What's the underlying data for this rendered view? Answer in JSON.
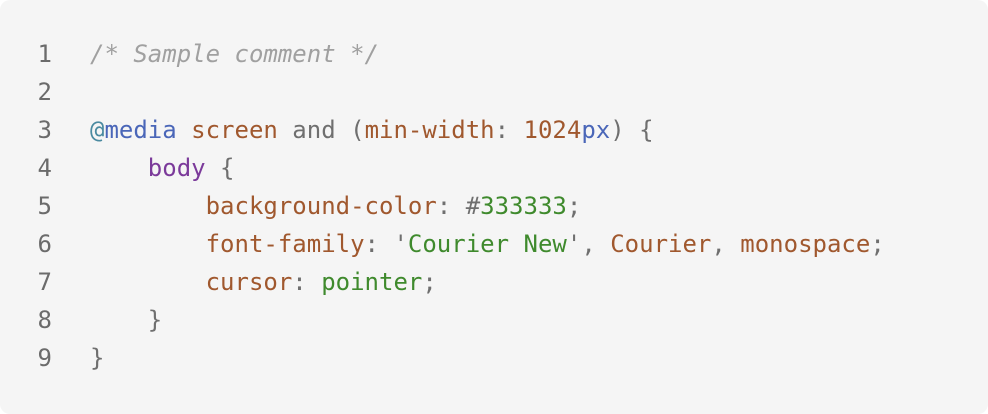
{
  "code": {
    "lines": [
      [
        {
          "text": "/* Sample comment */",
          "type": "comment"
        }
      ],
      [],
      [
        {
          "text": "@",
          "type": "at"
        },
        {
          "text": "media",
          "type": "keyword"
        },
        {
          "text": " ",
          "type": "punct"
        },
        {
          "text": "screen",
          "type": "ident"
        },
        {
          "text": " and ",
          "type": "punct"
        },
        {
          "text": "(",
          "type": "punct"
        },
        {
          "text": "min-width",
          "type": "ident"
        },
        {
          "text": ": ",
          "type": "punct"
        },
        {
          "text": "1024",
          "type": "num"
        },
        {
          "text": "px",
          "type": "unit"
        },
        {
          "text": ") {",
          "type": "punct"
        }
      ],
      [
        {
          "text": "    ",
          "type": "punct"
        },
        {
          "text": "body",
          "type": "selector"
        },
        {
          "text": " {",
          "type": "punct"
        }
      ],
      [
        {
          "text": "        ",
          "type": "punct"
        },
        {
          "text": "background-color",
          "type": "prop"
        },
        {
          "text": ": ",
          "type": "punct"
        },
        {
          "text": "#",
          "type": "hash"
        },
        {
          "text": "333333",
          "type": "value"
        },
        {
          "text": ";",
          "type": "punct"
        }
      ],
      [
        {
          "text": "        ",
          "type": "punct"
        },
        {
          "text": "font-family",
          "type": "prop"
        },
        {
          "text": ": ",
          "type": "punct"
        },
        {
          "text": "'",
          "type": "punct"
        },
        {
          "text": "Courier New",
          "type": "value"
        },
        {
          "text": "'",
          "type": "punct"
        },
        {
          "text": ", ",
          "type": "punct"
        },
        {
          "text": "Courier",
          "type": "prop"
        },
        {
          "text": ", ",
          "type": "punct"
        },
        {
          "text": "monospace",
          "type": "prop"
        },
        {
          "text": ";",
          "type": "punct"
        }
      ],
      [
        {
          "text": "        ",
          "type": "punct"
        },
        {
          "text": "cursor",
          "type": "prop"
        },
        {
          "text": ": ",
          "type": "punct"
        },
        {
          "text": "pointer",
          "type": "value"
        },
        {
          "text": ";",
          "type": "punct"
        }
      ],
      [
        {
          "text": "    ",
          "type": "punct"
        },
        {
          "text": "}",
          "type": "punct"
        }
      ],
      [
        {
          "text": "}",
          "type": "punct"
        }
      ]
    ],
    "line_numbers": [
      "1",
      "2",
      "3",
      "4",
      "5",
      "6",
      "7",
      "8",
      "9"
    ]
  },
  "colors": {
    "background": "#f5f5f5",
    "comment": "#a0a0a0",
    "keyword": "#4a66b8",
    "ident": "#a0582e",
    "selector": "#7b3a9a",
    "value": "#3f8a2d",
    "punct": "#6f6f6f"
  }
}
